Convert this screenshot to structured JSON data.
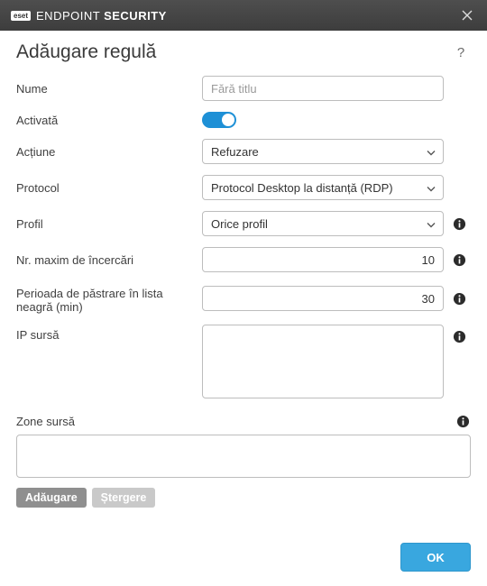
{
  "titlebar": {
    "brand_badge": "eset",
    "brand_text_light": "ENDPOINT",
    "brand_text_bold": "SECURITY"
  },
  "header": {
    "title": "Adăugare regulă"
  },
  "form": {
    "name": {
      "label": "Nume",
      "placeholder": "Fără titlu",
      "value": ""
    },
    "enabled": {
      "label": "Activată",
      "value": true
    },
    "action": {
      "label": "Acțiune",
      "selected": "Refuzare"
    },
    "protocol": {
      "label": "Protocol",
      "selected": "Protocol Desktop la distanță (RDP)"
    },
    "profile": {
      "label": "Profil",
      "selected": "Orice profil"
    },
    "max_attempts": {
      "label": "Nr. maxim de încercări",
      "value": "10"
    },
    "blacklist_period": {
      "label": "Perioada de păstrare în lista neagră (min)",
      "value": "30"
    },
    "source_ip": {
      "label": "IP sursă",
      "value": ""
    }
  },
  "zones": {
    "label": "Zone sursă",
    "value": ""
  },
  "buttons": {
    "add": "Adăugare",
    "delete": "Ștergere",
    "ok": "OK"
  }
}
